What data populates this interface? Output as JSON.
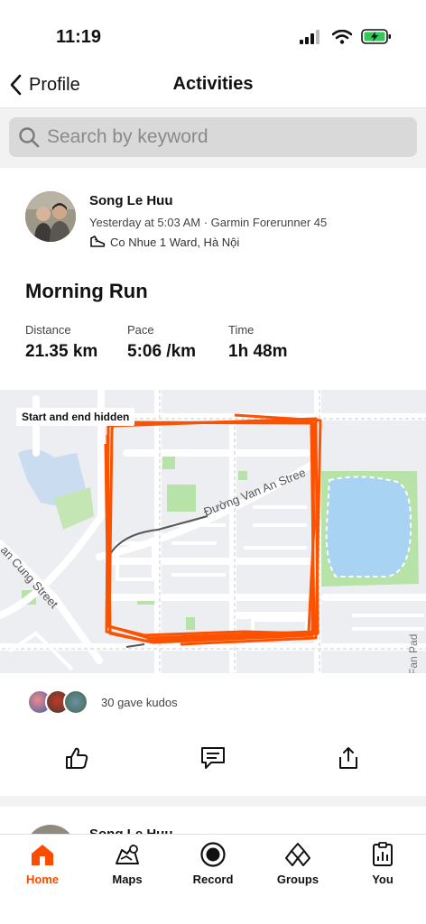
{
  "status_bar": {
    "time": "11:19"
  },
  "nav": {
    "back_label": "Profile",
    "title": "Activities"
  },
  "search": {
    "placeholder": "Search by keyword"
  },
  "activity": {
    "athlete": "Song Le Huu",
    "meta": "Yesterday at 5:03 AM · Garmin Forerunner 45",
    "location": "Co Nhue 1 Ward, Hà Nội",
    "title": "Morning Run",
    "stats": [
      {
        "label": "Distance",
        "value": "21.35 km"
      },
      {
        "label": "Pace",
        "value": "5:06 /km"
      },
      {
        "label": "Time",
        "value": "1h 48m"
      }
    ],
    "map": {
      "badge": "Start and end hidden",
      "street_1": "Đường Van An Stree",
      "street_2": "an Cung Street",
      "street_3": "Fan Pad"
    },
    "kudos": "30 gave kudos"
  },
  "next_activity": {
    "athlete": "Song Le Huu"
  },
  "tabs": [
    {
      "label": "Home",
      "icon": "home-icon",
      "active": true
    },
    {
      "label": "Maps",
      "icon": "maps-icon"
    },
    {
      "label": "Record",
      "icon": "record-icon"
    },
    {
      "label": "Groups",
      "icon": "groups-icon"
    },
    {
      "label": "You",
      "icon": "you-icon"
    }
  ],
  "colors": {
    "accent": "#fc4c02",
    "route": "#fc5200",
    "water": "#a9d3f2",
    "park": "#b7e3a8"
  }
}
